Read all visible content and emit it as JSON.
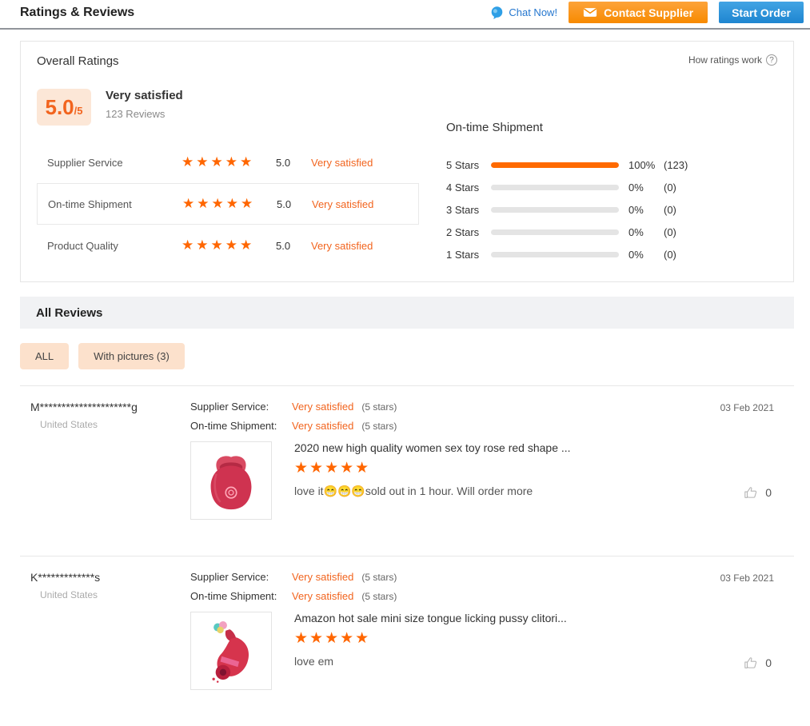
{
  "header": {
    "title": "Ratings & Reviews",
    "chat_now": "Chat Now!",
    "contact_supplier": "Contact Supplier",
    "start_order": "Start Order"
  },
  "colors": {
    "accent_orange_text": "#f2641e",
    "star_orange": "#ff6600",
    "bar_orange": "#ff6a00",
    "button_orange": "#f78a00",
    "button_blue": "#1e85d0",
    "link_blue": "#2577cf",
    "badge_bg": "#fce7d7",
    "chip_bg": "#fce1cc"
  },
  "overall": {
    "heading": "Overall Ratings",
    "how_ratings_work": "How ratings work",
    "score": "5.0",
    "score_suffix": "/5",
    "verdict": "Very satisfied",
    "reviews_count": "123 Reviews",
    "rows": [
      {
        "label": "Supplier Service",
        "stars": "★★★★★",
        "score": "5.0",
        "verdict": "Very satisfied"
      },
      {
        "label": "On-time Shipment",
        "stars": "★★★★★",
        "score": "5.0",
        "verdict": "Very satisfied"
      },
      {
        "label": "Product Quality",
        "stars": "★★★★★",
        "score": "5.0",
        "verdict": "Very satisfied"
      }
    ],
    "histogram": {
      "title": "On-time Shipment",
      "rows": [
        {
          "label": "5 Stars",
          "value": 100,
          "percent": "100%",
          "count": "(123)"
        },
        {
          "label": "4 Stars",
          "value": 0,
          "percent": "0%",
          "count": "(0)"
        },
        {
          "label": "3 Stars",
          "value": 0,
          "percent": "0%",
          "count": "(0)"
        },
        {
          "label": "2 Stars",
          "value": 0,
          "percent": "0%",
          "count": "(0)"
        },
        {
          "label": "1 Stars",
          "value": 0,
          "percent": "0%",
          "count": "(0)"
        }
      ]
    }
  },
  "reviews": {
    "heading": "All Reviews",
    "filters": [
      {
        "label": "ALL"
      },
      {
        "label": "With pictures (3)"
      }
    ],
    "items": [
      {
        "user": "M*********************g",
        "country": "United States",
        "date": "03 Feb 2021",
        "ratings": [
          {
            "label": "Supplier Service:",
            "value": "Very satisfied",
            "detail": "(5 stars)"
          },
          {
            "label": "On-time Shipment:",
            "value": "Very satisfied",
            "detail": "(5 stars)"
          }
        ],
        "product_title": "2020 new high quality women sex toy rose red shape ...",
        "stars": "★★★★★",
        "text": "love it😁😁😁sold out in 1 hour. Will order more",
        "helpful_count": "0"
      },
      {
        "user": "K*************s",
        "country": "United States",
        "date": "03 Feb 2021",
        "ratings": [
          {
            "label": "Supplier Service:",
            "value": "Very satisfied",
            "detail": "(5 stars)"
          },
          {
            "label": "On-time Shipment:",
            "value": "Very satisfied",
            "detail": "(5 stars)"
          }
        ],
        "product_title": "Amazon hot sale mini size tongue licking pussy clitori...",
        "stars": "★★★★★",
        "text": "love em",
        "helpful_count": "0"
      }
    ]
  }
}
